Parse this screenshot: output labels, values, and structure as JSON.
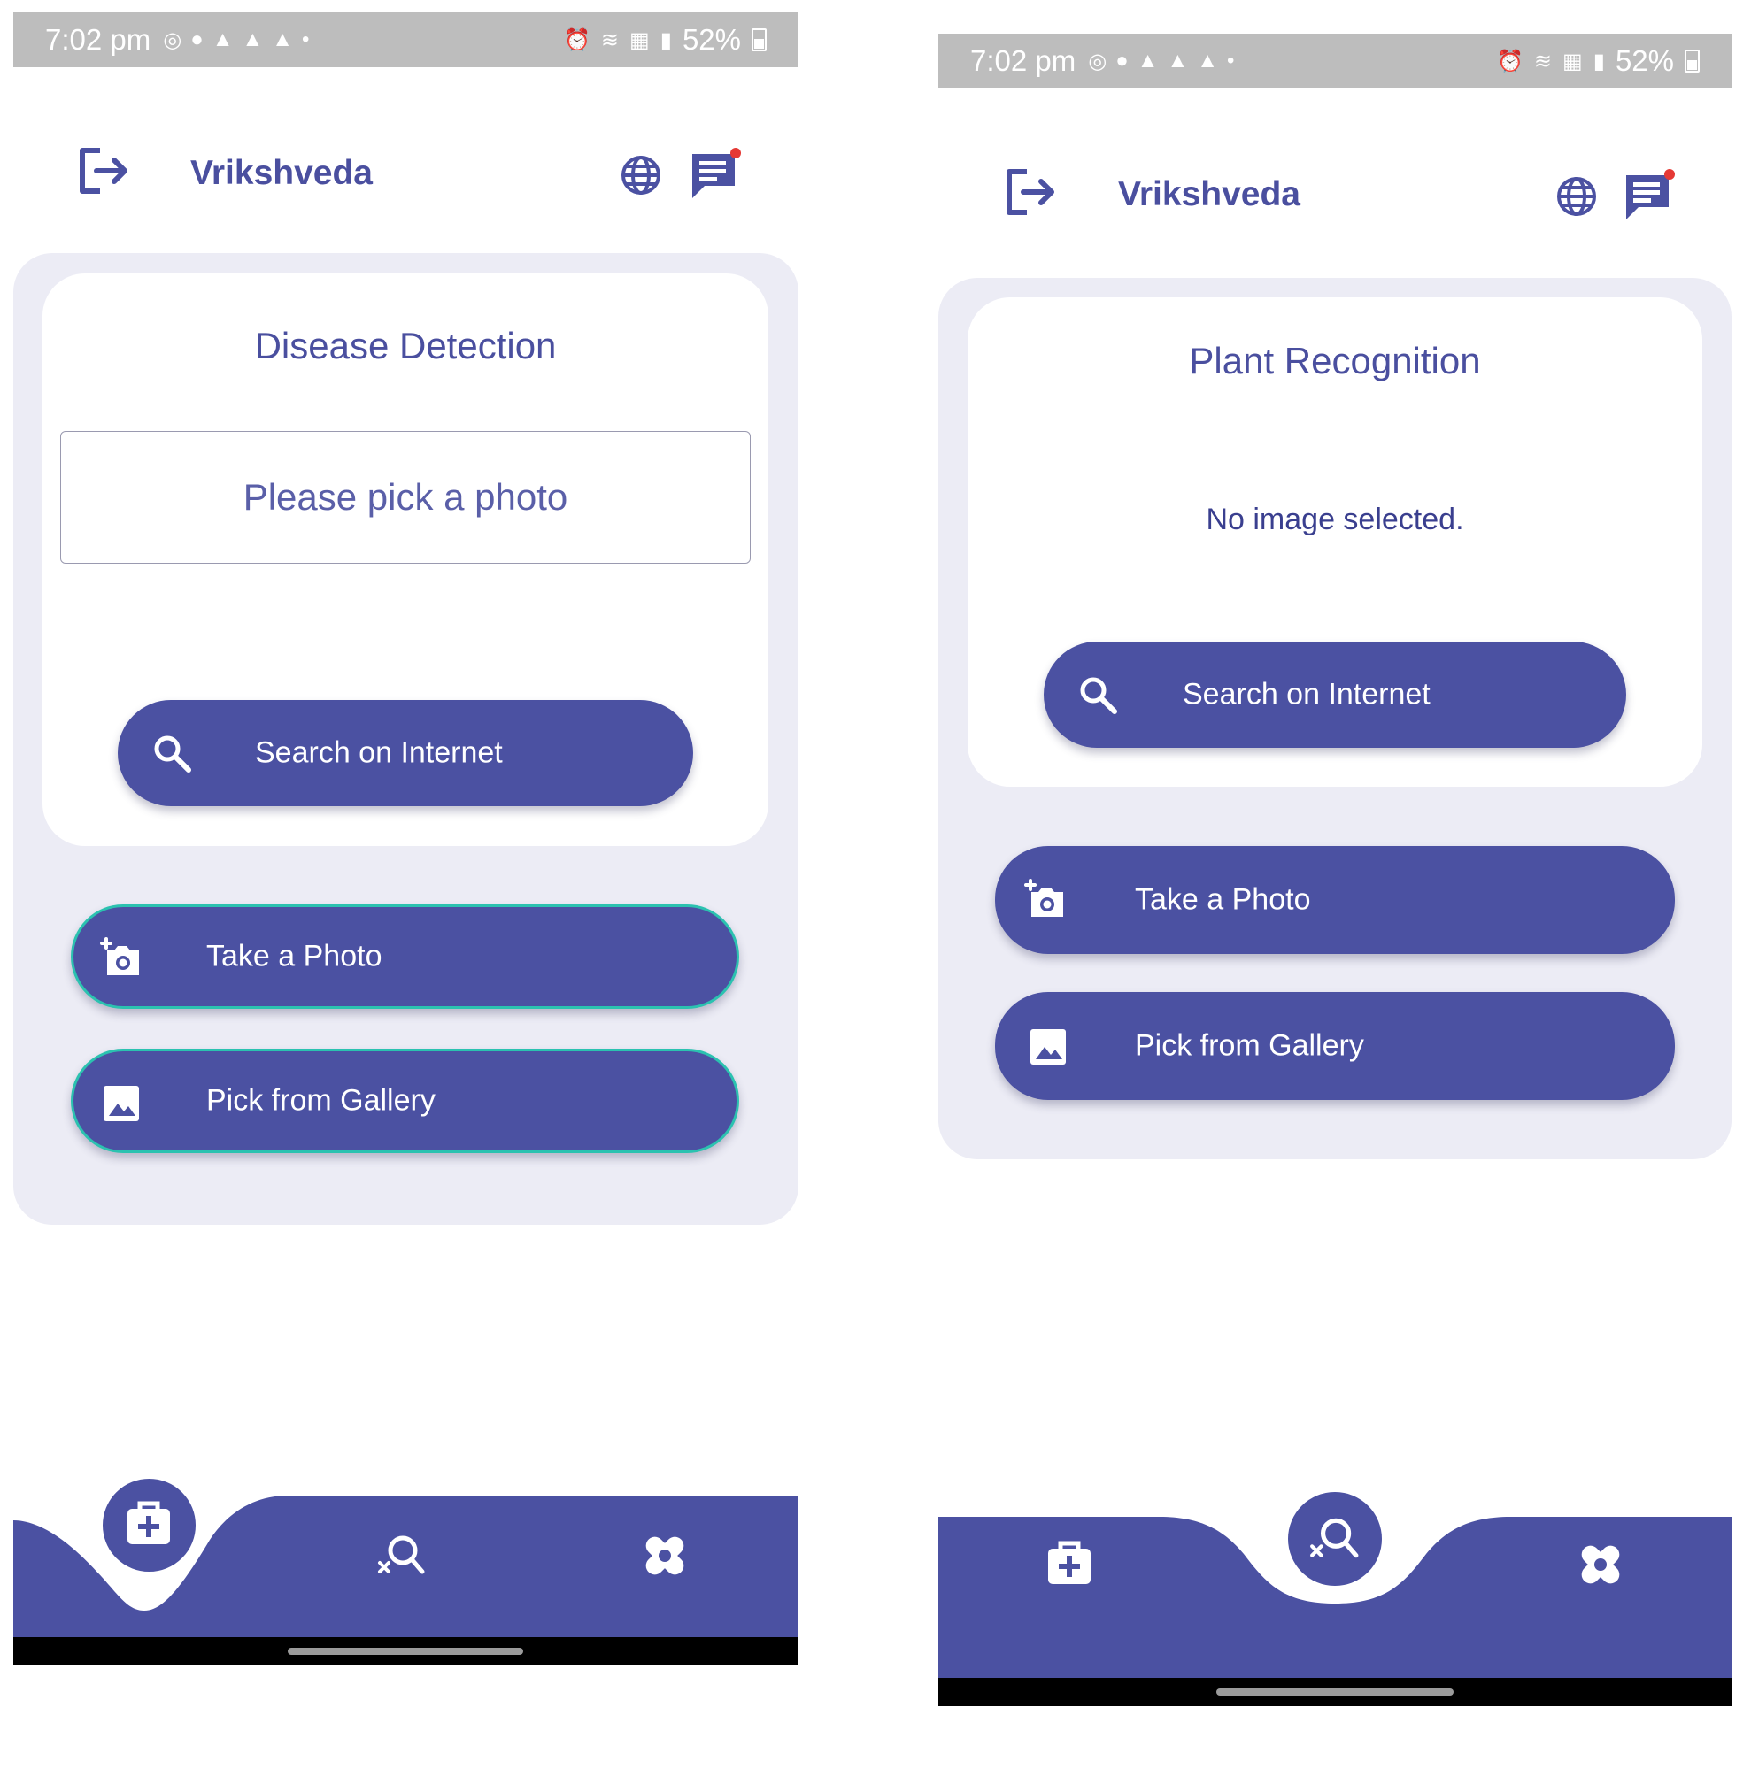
{
  "colors": {
    "primary": "#4b51a2",
    "title": "#4a4f9f",
    "panel": "#ececf5",
    "statusbar": "#bdbdbd",
    "accent_border": "#2bc2b0",
    "notification_dot": "#e53935"
  },
  "statusbar": {
    "time": "7:02 pm",
    "battery": "52%",
    "left_icons": [
      "whatsapp-icon",
      "chat-bubble-icon",
      "snapchat-icon",
      "snapchat-icon",
      "snapchat-icon",
      "dot-icon"
    ],
    "right_icons": [
      "alarm-icon",
      "wifi-icon",
      "volte-icon",
      "signal-icon",
      "battery-icon"
    ]
  },
  "app": {
    "title": "Vrikshveda"
  },
  "screens": [
    {
      "title": "Disease Detection",
      "photo_placeholder": "Please pick a photo",
      "search_label": "Search on Internet",
      "take_photo_label": "Take a Photo",
      "gallery_label": "Pick from Gallery",
      "active_tab": "disease-detection"
    },
    {
      "title": "Plant Recognition",
      "no_image_text": "No image selected.",
      "search_label": "Search on Internet",
      "take_photo_label": "Take a Photo",
      "gallery_label": "Pick from Gallery",
      "active_tab": "plant-recognition"
    }
  ],
  "nav_tabs": [
    {
      "icon": "medical-kit-icon"
    },
    {
      "icon": "plant-search-icon"
    },
    {
      "icon": "bandage-icon"
    }
  ]
}
